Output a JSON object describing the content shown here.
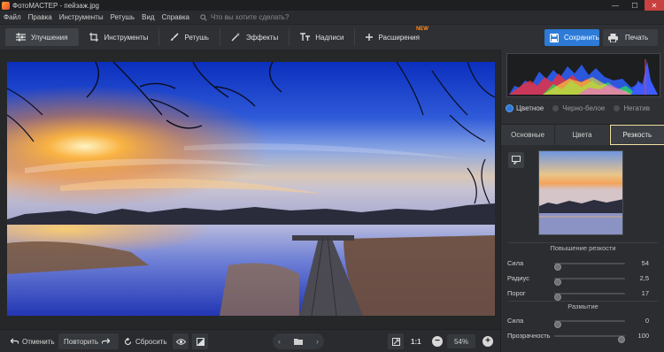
{
  "window": {
    "title": "ФотоМАСТЕР - пейзаж.jpg"
  },
  "menu": {
    "items": [
      "Файл",
      "Правка",
      "Инструменты",
      "Ретушь",
      "Вид",
      "Справка"
    ],
    "search_placeholder": "Что вы хотите сделать?"
  },
  "toolbar": {
    "tools": [
      {
        "label": "Улучшения",
        "icon": "sliders-icon",
        "active": true
      },
      {
        "label": "Инструменты",
        "icon": "crop-icon",
        "active": false
      },
      {
        "label": "Ретушь",
        "icon": "brush-icon",
        "active": false
      },
      {
        "label": "Эффекты",
        "icon": "magic-wand-icon",
        "active": false
      },
      {
        "label": "Надписи",
        "icon": "text-icon",
        "active": false
      },
      {
        "label": "Расширения",
        "icon": "plus-icon",
        "active": false,
        "badge": "NEW"
      }
    ],
    "save_label": "Сохранить",
    "print_label": "Печать"
  },
  "bottom": {
    "undo_label": "Отменить",
    "redo_label": "Повторить",
    "reset_label": "Сбросить",
    "ratio_label": "1:1",
    "zoom": "54%"
  },
  "panel": {
    "modes": [
      {
        "label": "Цветное",
        "selected": true
      },
      {
        "label": "Черно-белое",
        "selected": false
      },
      {
        "label": "Негатив",
        "selected": false
      }
    ],
    "tabs": [
      {
        "label": "Основные",
        "active": false
      },
      {
        "label": "Цвета",
        "active": false
      },
      {
        "label": "Резкость",
        "active": true
      }
    ],
    "sharpen": {
      "title": "Повышение резкости",
      "sliders": [
        {
          "label": "Сила",
          "value": "54",
          "fraction": 0.05
        },
        {
          "label": "Радиус",
          "value": "2,5",
          "fraction": 0.05
        },
        {
          "label": "Порог",
          "value": "17",
          "fraction": 0.05
        }
      ]
    },
    "blur": {
      "title": "Размытие",
      "sliders": [
        {
          "label": "Сила",
          "value": "0",
          "fraction": 0.05
        },
        {
          "label": "Прозрачность",
          "value": "100",
          "fraction": 0.95
        }
      ]
    }
  },
  "colors": {
    "accent": "#2e7bd7",
    "badge": "#ff8a1e",
    "active_tab_border": "#f2e2a8"
  }
}
